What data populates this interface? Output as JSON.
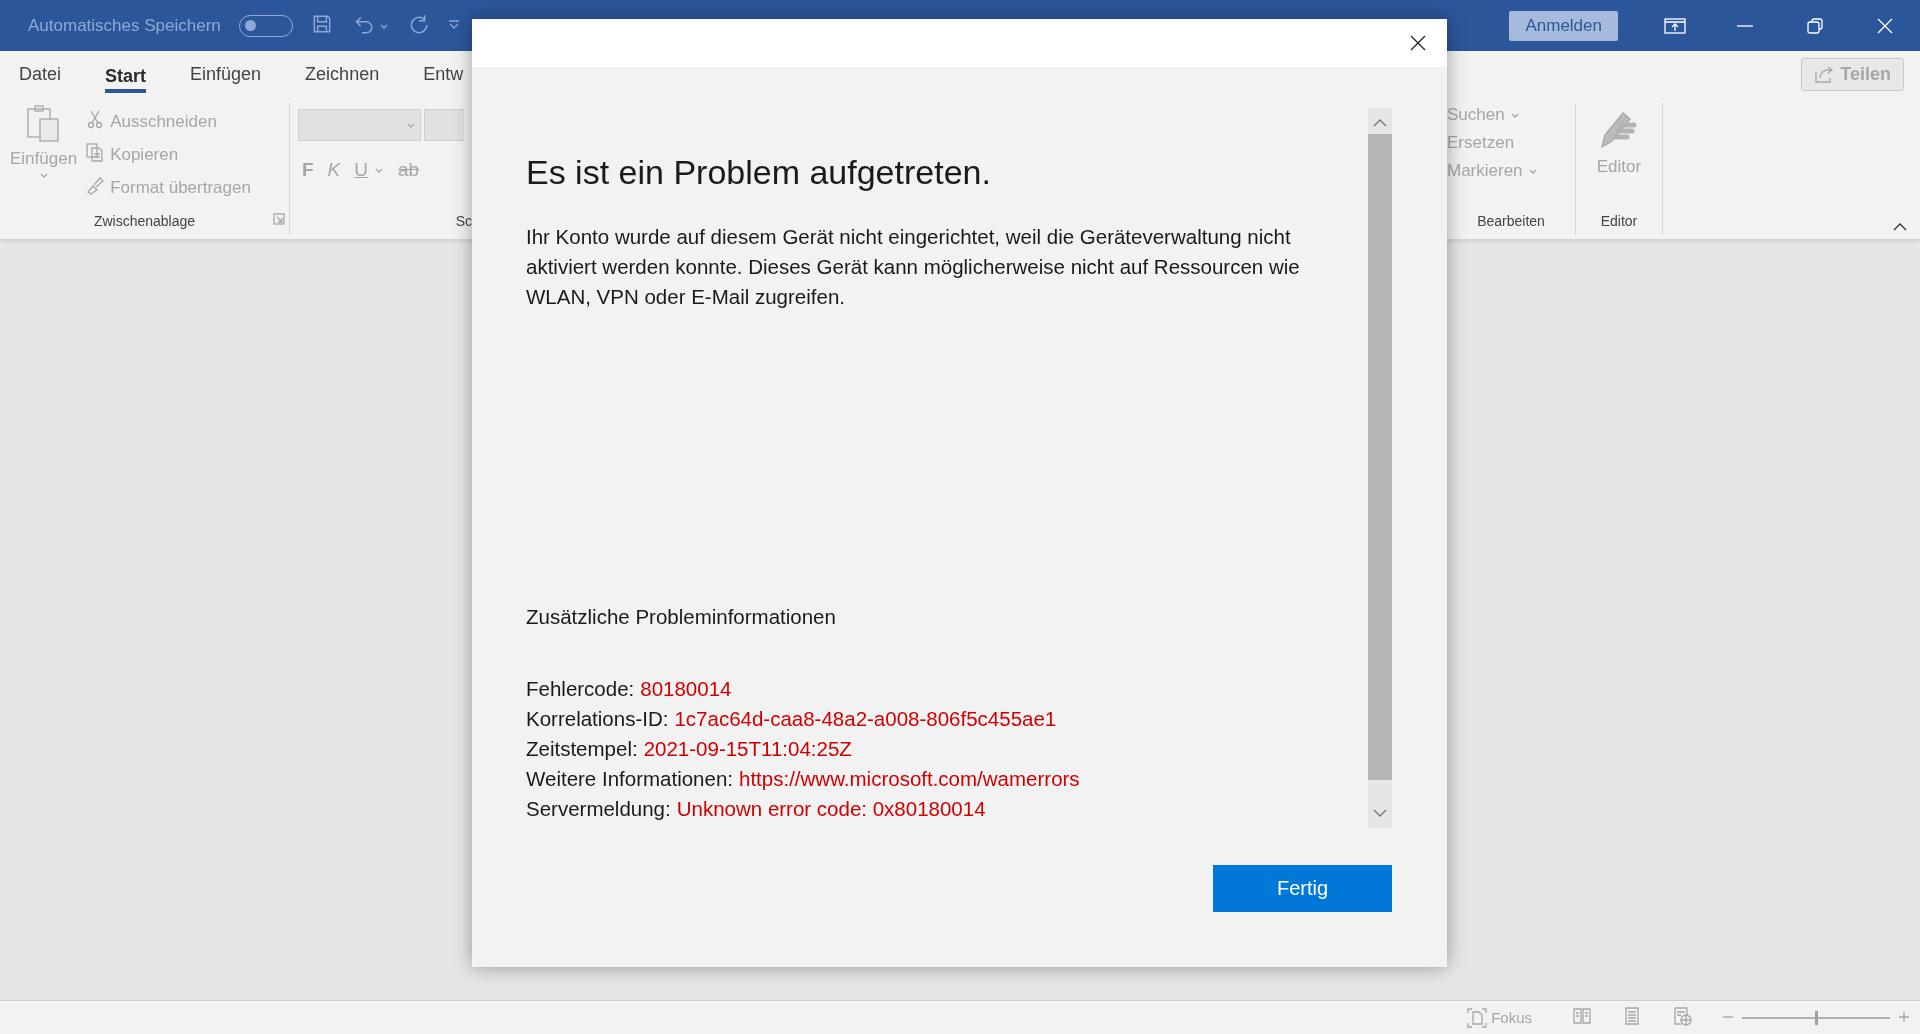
{
  "title_bar": {
    "autosave_label": "Automatisches Speichern",
    "autosave_on": false,
    "sign_in_button": "Anmelden"
  },
  "ribbon": {
    "tabs": [
      {
        "label": "Datei",
        "selected": false
      },
      {
        "label": "Start",
        "selected": true
      },
      {
        "label": "Einfügen",
        "selected": false
      },
      {
        "label": "Zeichnen",
        "selected": false
      },
      {
        "label": "Entw",
        "selected": false
      }
    ],
    "share_button": "Teilen",
    "clipboard_group": {
      "paste_button": "Einfügen",
      "items": [
        {
          "kind": "cut",
          "label": "Ausschneiden"
        },
        {
          "kind": "copy",
          "label": "Kopieren"
        },
        {
          "kind": "format",
          "label": "Format übertragen"
        }
      ],
      "label": "Zwischenablage"
    },
    "font_group": {
      "buttons": [
        {
          "kind": "bold",
          "label": "F"
        },
        {
          "kind": "italic",
          "label": "K"
        },
        {
          "kind": "underline",
          "label": "U"
        },
        {
          "kind": "strike",
          "label": "ab"
        }
      ],
      "label": "Sc"
    },
    "editing_group": {
      "items": [
        {
          "label": "Suchen",
          "dropdown": true
        },
        {
          "label": "Ersetzen",
          "dropdown": false
        },
        {
          "label": "Markieren",
          "dropdown": true
        }
      ],
      "label": "Bearbeiten"
    },
    "editor_group": {
      "button": "Editor",
      "label": "Editor"
    }
  },
  "dialog": {
    "title": "Es ist ein Problem aufgetreten.",
    "message": "Ihr Konto wurde auf diesem Gerät nicht eingerichtet, weil die Geräteverwaltung nicht aktiviert werden konnte. Dieses Gerät kann möglicherweise nicht auf Ressourcen wie WLAN, VPN oder E-Mail zugreifen.",
    "details_heading": "Zusätzliche Probleminformationen",
    "details": [
      {
        "label": "Fehlercode:",
        "value": "80180014"
      },
      {
        "label": "Korrelations-ID:",
        "value": "1c7ac64d-caa8-48a2-a008-806f5c455ae1"
      },
      {
        "label": "Zeitstempel:",
        "value": "2021-09-15T11:04:25Z"
      },
      {
        "label": "Weitere Informationen:",
        "value": "https://www.microsoft.com/wamerrors"
      },
      {
        "label": "Servermeldung:",
        "value": "Unknown error code: 0x80180014"
      }
    ],
    "done_button": "Fertig"
  },
  "status_bar": {
    "focus_button": "Fokus",
    "zoom_slider": {
      "level": 0.5
    }
  }
}
